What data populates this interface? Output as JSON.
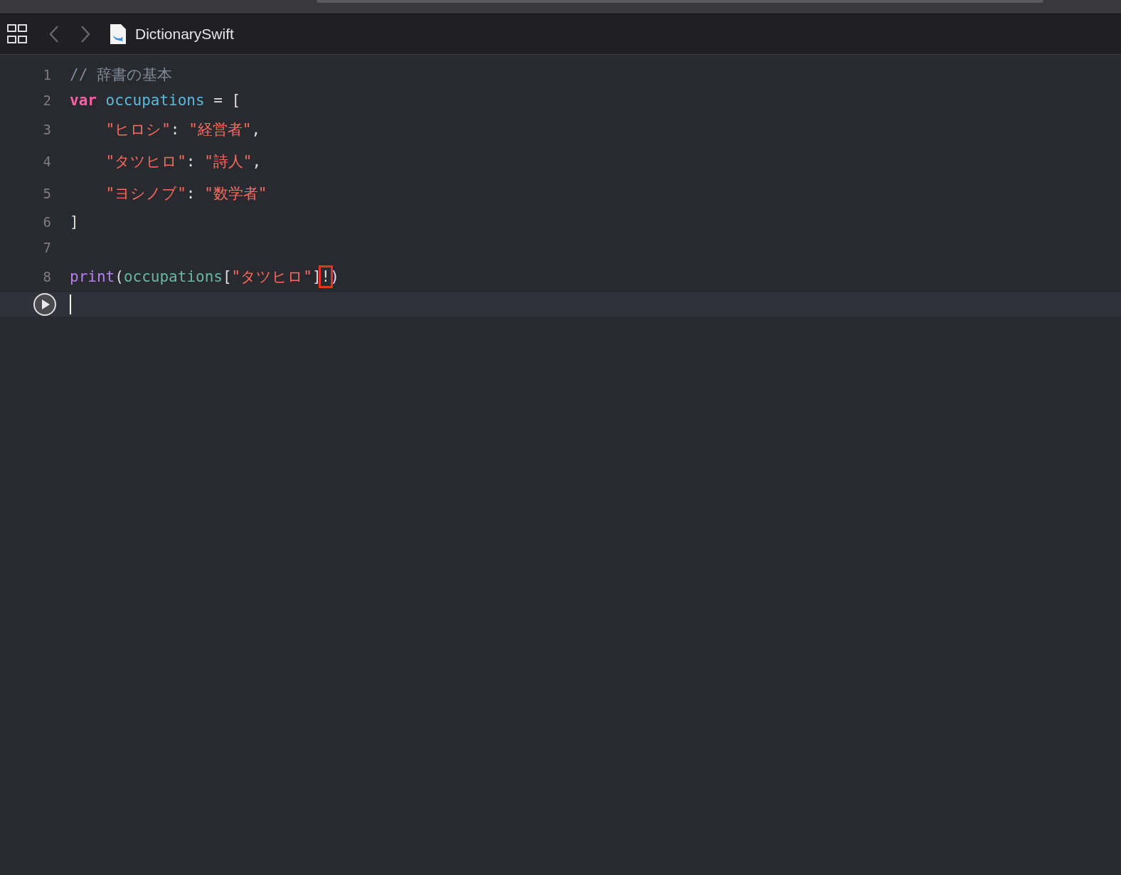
{
  "editor_tab": {
    "title": "DictionarySwift"
  },
  "lines": [
    {
      "number": "1",
      "current": false,
      "indent": false,
      "tokens": [
        {
          "text": "// 辞書の基本",
          "kind": "comment"
        }
      ]
    },
    {
      "number": "2",
      "current": false,
      "indent": false,
      "tokens": [
        {
          "text": "var",
          "kind": "keyword"
        },
        {
          "text": "occupations",
          "kind": "declaration"
        },
        {
          "text": " = [",
          "kind": "plain"
        }
      ]
    },
    {
      "number": "3",
      "current": false,
      "indent": true,
      "tokens": [
        {
          "text": "\"ヒロシ\"",
          "kind": "string"
        },
        {
          "text": ": ",
          "kind": "plain"
        },
        {
          "text": "\"経営者\"",
          "kind": "string"
        },
        {
          "text": ",",
          "kind": "plain"
        }
      ]
    },
    {
      "number": "4",
      "current": false,
      "indent": true,
      "tokens": [
        {
          "text": "\"タツヒロ\"",
          "kind": "string"
        },
        {
          "text": ": ",
          "kind": "plain"
        },
        {
          "text": "\"詩人\"",
          "kind": "string"
        },
        {
          "text": ",",
          "kind": "plain"
        }
      ]
    },
    {
      "number": "5",
      "current": false,
      "indent": true,
      "tokens": [
        {
          "text": "\"ヨシノブ\"",
          "kind": "string"
        },
        {
          "text": ": ",
          "kind": "plain"
        },
        {
          "text": "\"数学者\"",
          "kind": "string"
        }
      ]
    },
    {
      "number": "6",
      "current": false,
      "indent": false,
      "tokens": [
        {
          "text": "]",
          "kind": "plain"
        }
      ]
    },
    {
      "number": "7",
      "current": false
    },
    {
      "number": "8",
      "current": false,
      "indent": false,
      "tokens": [
        {
          "text": "print",
          "kind": "function"
        },
        {
          "text": "(",
          "kind": "plain"
        },
        {
          "text": "occupations",
          "kind": "reference"
        },
        {
          "text": "[",
          "kind": "plain"
        },
        {
          "text": "\"タツヒロ\"",
          "kind": "string"
        },
        {
          "text": "]",
          "kind": "plain"
        },
        {
          "text": "!",
          "kind": "flagged"
        },
        {
          "text": ")",
          "kind": "plain"
        }
      ]
    },
    {
      "current": true
    }
  ]
}
